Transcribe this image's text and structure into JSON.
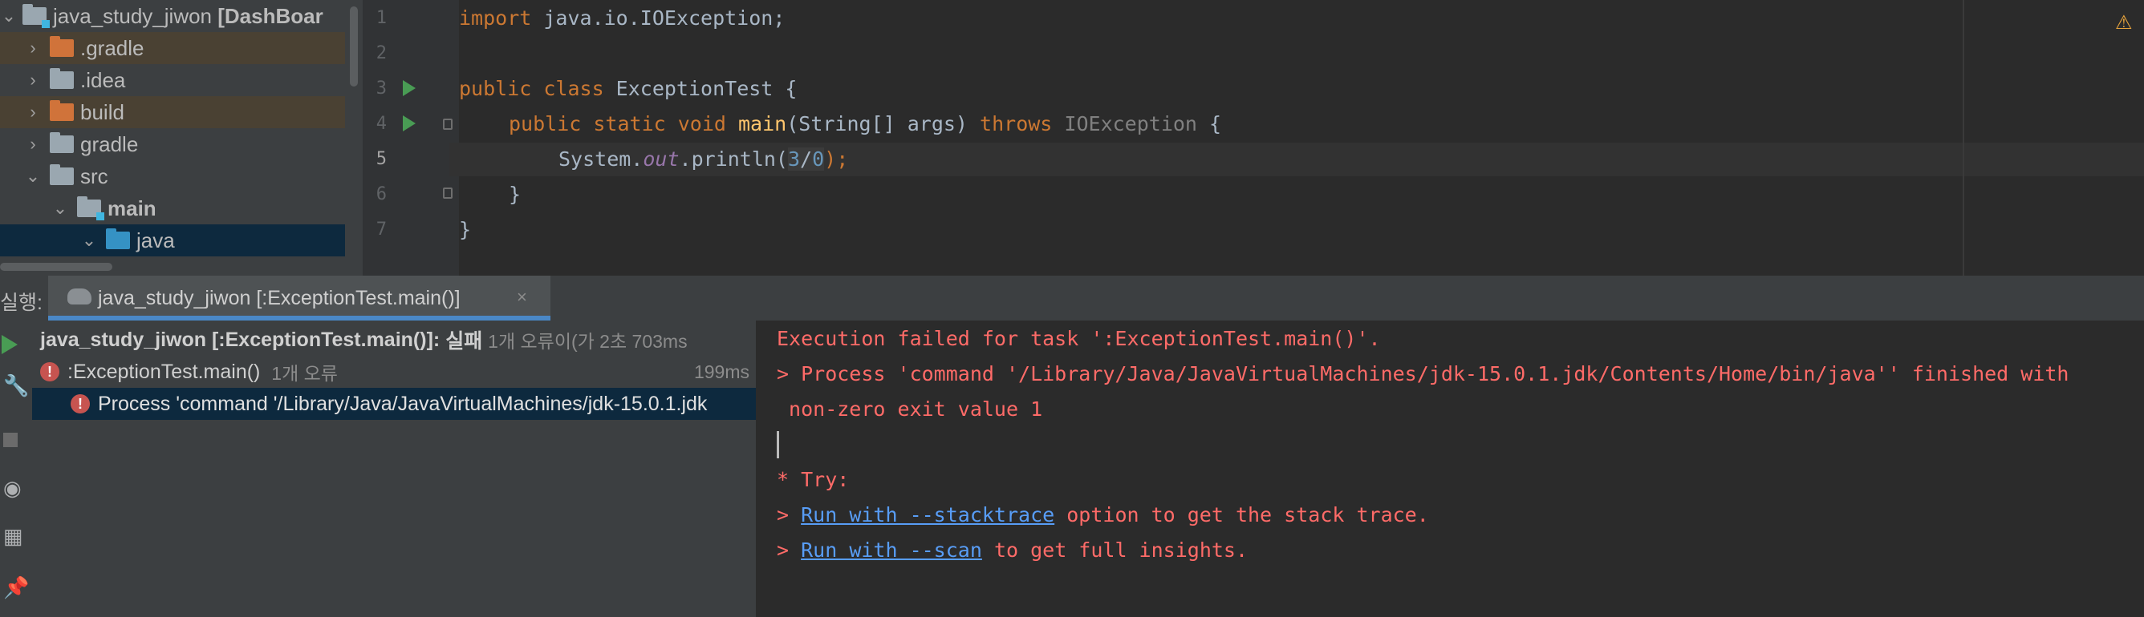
{
  "project_tree": {
    "root": {
      "name": "java_study_jiwon",
      "suffix": "[DashBoar"
    },
    "items": [
      {
        "label": ".gradle",
        "expanded": false
      },
      {
        "label": ".idea",
        "expanded": false
      },
      {
        "label": "build",
        "expanded": false
      },
      {
        "label": "gradle",
        "expanded": false
      },
      {
        "label": "src",
        "expanded": true
      },
      {
        "label": "main",
        "expanded": true
      },
      {
        "label": "java",
        "expanded": true
      }
    ]
  },
  "editor": {
    "line_numbers": [
      "1",
      "2",
      "3",
      "4",
      "5",
      "6",
      "7"
    ],
    "line1": {
      "kw": "import",
      "rest": " java.io.IOException;"
    },
    "line3": {
      "kw": "public class",
      "rest": " ExceptionTest {"
    },
    "line4": {
      "kw": "public static void",
      "fn": "main",
      "params": "(String[] args) ",
      "throws": "throws",
      "exc": "IOException",
      "brace": " {"
    },
    "line5": {
      "pre": "System.",
      "static_field": "out",
      "call": ".println(",
      "num1": "3",
      "op": "/",
      "num2": "0",
      "post": ");"
    },
    "line6": "}",
    "line7": "}",
    "warning_icon": "⚠"
  },
  "run_bar": {
    "label": "실행:",
    "tab_title": "java_study_jiwon [:ExceptionTest.main()]",
    "close": "×"
  },
  "run_tree": {
    "rows": [
      {
        "title": "java_study_jiwon [:ExceptionTest.main()]:",
        "status": "실패",
        "detail": "1개 오류이(가 2초 703ms",
        "time": ""
      },
      {
        "title": ":ExceptionTest.main()",
        "detail": "1개 오류",
        "time": "199ms"
      },
      {
        "title": "Process 'command '/Library/Java/JavaVirtualMachines/jdk-15.0.1.jdk"
      }
    ]
  },
  "console": {
    "line1": "Execution failed for task ':ExceptionTest.main()'.",
    "line2": "> Process 'command '/Library/Java/JavaVirtualMachines/jdk-15.0.1.jdk/Contents/Home/bin/java'' finished with",
    "line3": " non-zero exit value 1",
    "line4": "* Try:",
    "line5_prefix": "> ",
    "line5_link": "Run with --stacktrace",
    "line5_suffix": " option to get the stack trace.",
    "line6_prefix": "> ",
    "line6_link": "Run with --scan",
    "line6_suffix": " to get full insights."
  }
}
